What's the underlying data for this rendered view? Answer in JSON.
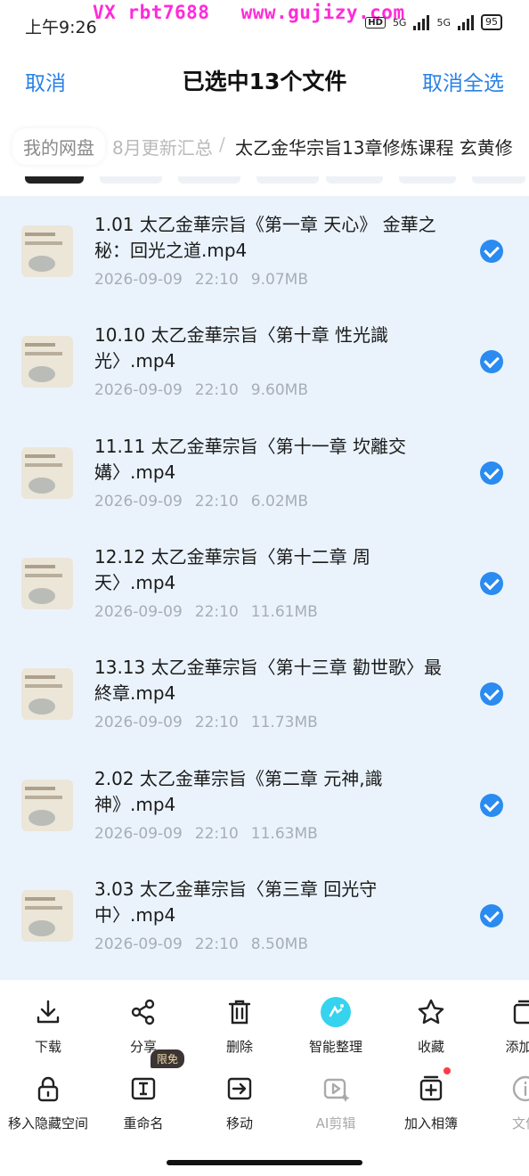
{
  "status_bar": {
    "time": "上午9:26",
    "watermark_left": "VX rbt7688",
    "watermark_right": "www.gujizy.com",
    "network_1": "5G",
    "network_2": "5G",
    "hd": "HD",
    "battery": "95"
  },
  "header": {
    "cancel_label": "取消",
    "title": "已选中13个文件",
    "deselect_label": "取消全选"
  },
  "breadcrumb": {
    "root": "我的网盘",
    "middle": "8月更新汇总",
    "separator": "/",
    "current": "太乙金华宗旨13章修炼课程 玄黄修"
  },
  "files": [
    {
      "name": "1.01 太乙金華宗旨《第一章 天心》 金華之秘：回光之道.mp4",
      "date": "2026-09-09",
      "time": "22:10",
      "size": "9.07MB",
      "selected": true
    },
    {
      "name": "10.10 太乙金華宗旨〈第十章 性光識光〉.mp4",
      "date": "2026-09-09",
      "time": "22:10",
      "size": "9.60MB",
      "selected": true
    },
    {
      "name": "11.11 太乙金華宗旨〈第十一章 坎離交媾〉.mp4",
      "date": "2026-09-09",
      "time": "22:10",
      "size": "6.02MB",
      "selected": true
    },
    {
      "name": "12.12 太乙金華宗旨〈第十二章 周天〉.mp4",
      "date": "2026-09-09",
      "time": "22:10",
      "size": "11.61MB",
      "selected": true
    },
    {
      "name": "13.13 太乙金華宗旨〈第十三章 勸世歌〉最終章.mp4",
      "date": "2026-09-09",
      "time": "22:10",
      "size": "11.73MB",
      "selected": true
    },
    {
      "name": "2.02 太乙金華宗旨《第二章 元神,識神》.mp4",
      "date": "2026-09-09",
      "time": "22:10",
      "size": "11.63MB",
      "selected": true
    },
    {
      "name": "3.03 太乙金華宗旨〈第三章 回光守中〉.mp4",
      "date": "2026-09-09",
      "time": "22:10",
      "size": "8.50MB",
      "selected": true
    }
  ],
  "toolbar": {
    "row1": [
      {
        "label": "下载",
        "icon": "download-icon"
      },
      {
        "label": "分享",
        "icon": "share-icon"
      },
      {
        "label": "删除",
        "icon": "trash-icon"
      },
      {
        "label": "智能整理",
        "icon": "smart-organize-icon"
      },
      {
        "label": "收藏",
        "icon": "star-icon"
      },
      {
        "label": "添加到",
        "icon": "add-to-icon"
      }
    ],
    "row2": [
      {
        "label": "移入隐藏空间",
        "icon": "lock-icon"
      },
      {
        "label": "重命名",
        "icon": "rename-icon",
        "badge": "限免"
      },
      {
        "label": "移动",
        "icon": "move-icon"
      },
      {
        "label": "AI剪辑",
        "icon": "ai-edit-icon",
        "disabled": true
      },
      {
        "label": "加入相簿",
        "icon": "add-album-icon",
        "dot": true
      },
      {
        "label": "文件",
        "icon": "info-icon",
        "disabled": true
      }
    ]
  },
  "colors": {
    "accent": "#2a82e4",
    "list_bg": "#eaf3fc",
    "check": "#2a8bf0",
    "watermark": "#ff2ad9"
  }
}
